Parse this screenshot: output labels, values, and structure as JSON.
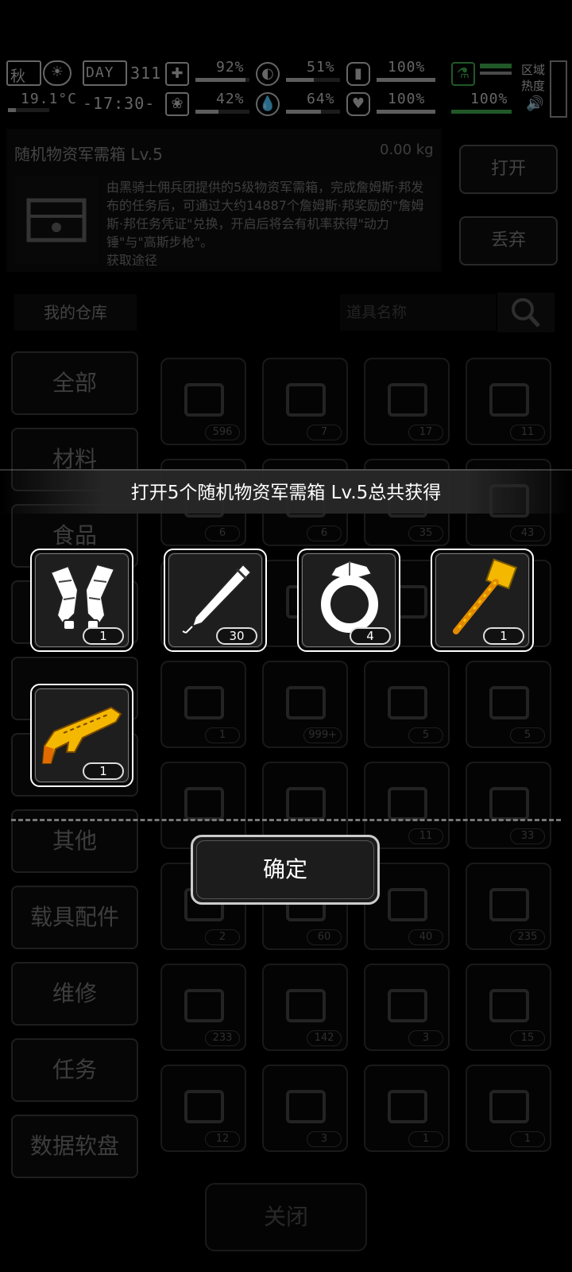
{
  "status": {
    "season": "秋",
    "temperature": "19.1°C",
    "day_label": "DAY",
    "day_number": "311",
    "time": "-17:30-",
    "health_pct": "92%",
    "health_fill": 0.92,
    "stomach_pct": "51%",
    "stomach_fill": 0.51,
    "battery_pct": "100%",
    "battery_fill": 1.0,
    "mind_pct": "42%",
    "mind_fill": 0.42,
    "water_pct": "64%",
    "water_fill": 0.64,
    "heart_pct": "100%",
    "heart_fill": 1.0,
    "radiation_pct": "100%",
    "radiation_fill": 1.0,
    "zone_label": "区域热度",
    "accent_green": "#3da14a"
  },
  "item": {
    "title": "随机物资军需箱 Lv.5",
    "weight": "0.00 kg",
    "description": "由黑骑士佣兵团提供的5级物资军需箱，完成詹姆斯·邦发布的任务后，可通过大约14887个詹姆斯·邦奖励的\"詹姆斯·邦任务凭证\"兑换，开启后将会有机率获得\"动力锤\"与\"高斯步枪\"。",
    "description_cut": "获取途径",
    "open_label": "打开",
    "discard_label": "丢弃"
  },
  "warehouse": {
    "tab_label": "我的仓库",
    "search_placeholder": "道具名称"
  },
  "categories": [
    "全部",
    "材料",
    "食品",
    "",
    "",
    "",
    "其他",
    "载具配件",
    "维修",
    "任务",
    "数据软盘"
  ],
  "grid_counts": [
    [
      "596",
      "7",
      "17",
      "11"
    ],
    [
      "6",
      "6",
      "35",
      "43"
    ],
    [
      "",
      "",
      "",
      ""
    ],
    [
      "1",
      "999+",
      "5",
      "5"
    ],
    [
      "",
      "",
      "11",
      "33"
    ],
    [
      "2",
      "60",
      "40",
      "235"
    ],
    [
      "233",
      "142",
      "3",
      "15"
    ],
    [
      "12",
      "3",
      "1",
      "1"
    ]
  ],
  "reward": {
    "title": "打开5个随机物资军需箱 Lv.5总共获得",
    "items": [
      {
        "icon": "power-armor-legs-icon",
        "count": "1"
      },
      {
        "icon": "pen-icon",
        "count": "30"
      },
      {
        "icon": "diamond-ring-icon",
        "count": "4"
      },
      {
        "icon": "power-hammer-icon",
        "count": "1"
      },
      {
        "icon": "gauss-rifle-icon",
        "count": "1"
      }
    ],
    "confirm_label": "确定",
    "gold_color": "#f5b800"
  },
  "close_label": "关闭"
}
